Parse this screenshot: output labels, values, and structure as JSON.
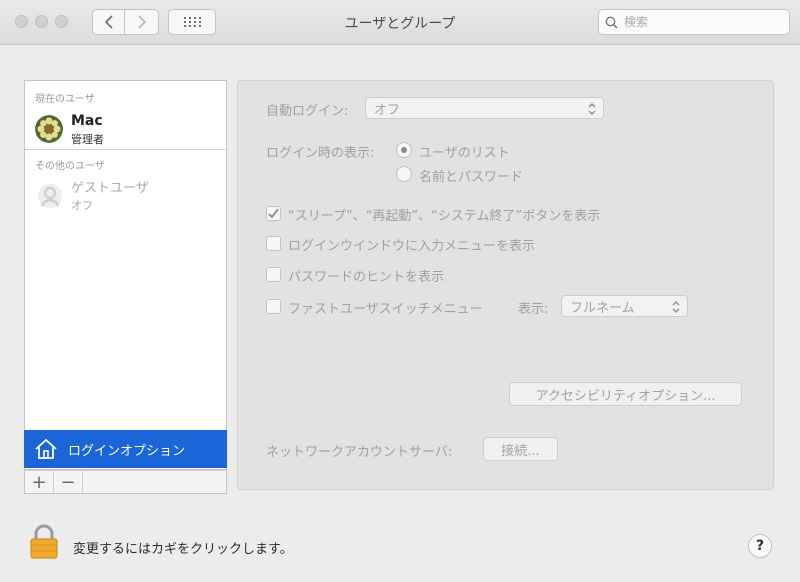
{
  "window": {
    "title": "ユーザとグループ"
  },
  "search": {
    "placeholder": "検索"
  },
  "sidebar": {
    "current_users_header": "現在のユーザ",
    "current_user": {
      "name": "Mac",
      "role": "管理者"
    },
    "other_users_header": "その他のユーザ",
    "guest_user": {
      "name": "ゲストユーザ",
      "status": "オフ"
    },
    "login_options_label": "ログインオプション",
    "add_label": "+",
    "remove_label": "−"
  },
  "options": {
    "auto_login_label": "自動ログイン:",
    "auto_login_value": "オフ",
    "display_label": "ログイン時の表示:",
    "radio_user_list": "ユーザのリスト",
    "radio_name_password": "名前とパスワード",
    "check_buttons": "“スリープ”、“再起動”、“システム終了”ボタンを表示",
    "check_input_menu": "ログインウインドウに入力メニューを表示",
    "check_password_hint": "パスワードのヒントを表示",
    "check_fast_switch": "ファストユーザスイッチメニュー",
    "fast_switch_display_label": "表示:",
    "fast_switch_display_value": "フルネーム",
    "accessibility_button": "アクセシビリティオプション...",
    "network_server_label": "ネットワークアカウントサーバ:",
    "connect_button": "接続..."
  },
  "footer": {
    "lock_text": "変更するにはカギをクリックします。",
    "help_label": "?"
  }
}
